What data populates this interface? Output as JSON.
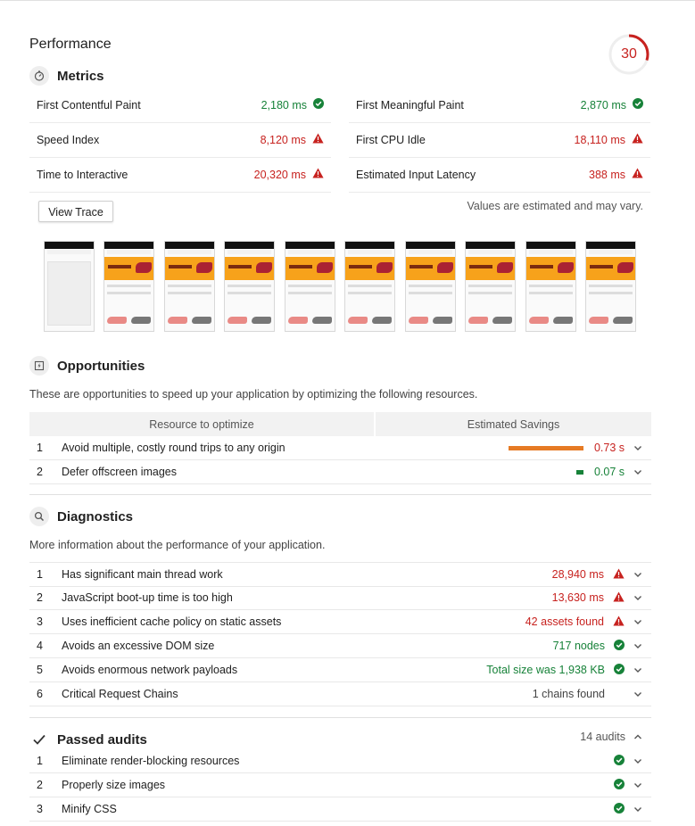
{
  "performance": {
    "title": "Performance",
    "score": "30"
  },
  "metrics": {
    "title": "Metrics",
    "items": [
      {
        "label": "First Contentful Paint",
        "value": "2,180 ms",
        "status": "pass"
      },
      {
        "label": "First Meaningful Paint",
        "value": "2,870 ms",
        "status": "pass"
      },
      {
        "label": "Speed Index",
        "value": "8,120 ms",
        "status": "fail"
      },
      {
        "label": "First CPU Idle",
        "value": "18,110 ms",
        "status": "fail"
      },
      {
        "label": "Time to Interactive",
        "value": "20,320 ms",
        "status": "fail"
      },
      {
        "label": "Estimated Input Latency",
        "value": "388 ms",
        "status": "fail"
      }
    ],
    "view_trace": "View Trace",
    "estimate_note": "Values are estimated and may vary."
  },
  "filmstrip": {
    "frame_count": 10
  },
  "opportunities": {
    "title": "Opportunities",
    "description": "These are opportunities to speed up your application by optimizing the following resources.",
    "col_resource": "Resource to optimize",
    "col_savings": "Estimated Savings",
    "items": [
      {
        "num": "1",
        "label": "Avoid multiple, costly round trips to any origin",
        "value": "0.73 s",
        "status": "fail",
        "bar_fraction": 1.0
      },
      {
        "num": "2",
        "label": "Defer offscreen images",
        "value": "0.07 s",
        "status": "pass",
        "bar_fraction": 0.09
      }
    ]
  },
  "diagnostics": {
    "title": "Diagnostics",
    "description": "More information about the performance of your application.",
    "items": [
      {
        "num": "1",
        "label": "Has significant main thread work",
        "value": "28,940 ms",
        "status": "fail"
      },
      {
        "num": "2",
        "label": "JavaScript boot-up time is too high",
        "value": "13,630 ms",
        "status": "fail"
      },
      {
        "num": "3",
        "label": "Uses inefficient cache policy on static assets",
        "value": "42 assets found",
        "status": "fail"
      },
      {
        "num": "4",
        "label": "Avoids an excessive DOM size",
        "value": "717 nodes",
        "status": "pass"
      },
      {
        "num": "5",
        "label": "Avoids enormous network payloads",
        "value": "Total size was 1,938 KB",
        "status": "pass"
      },
      {
        "num": "6",
        "label": "Critical Request Chains",
        "value": "1 chains found",
        "status": "info"
      }
    ]
  },
  "passed": {
    "title": "Passed audits",
    "count": "14 audits",
    "items": [
      {
        "num": "1",
        "label": "Eliminate render-blocking resources"
      },
      {
        "num": "2",
        "label": "Properly size images"
      },
      {
        "num": "3",
        "label": "Minify CSS"
      }
    ]
  },
  "colors": {
    "pass": "#178239",
    "fail": "#c7221f",
    "average": "#e67700",
    "accent_bar": "#e67a24"
  },
  "icons": {
    "metrics": "timer-icon",
    "opportunities": "lightning-doc-icon",
    "diagnostics": "search-icon",
    "passed": "checkmark-icon",
    "pass": "check-circle-icon",
    "fail": "warning-triangle-icon",
    "expand": "chevron-down-icon",
    "collapse": "chevron-up-icon"
  }
}
